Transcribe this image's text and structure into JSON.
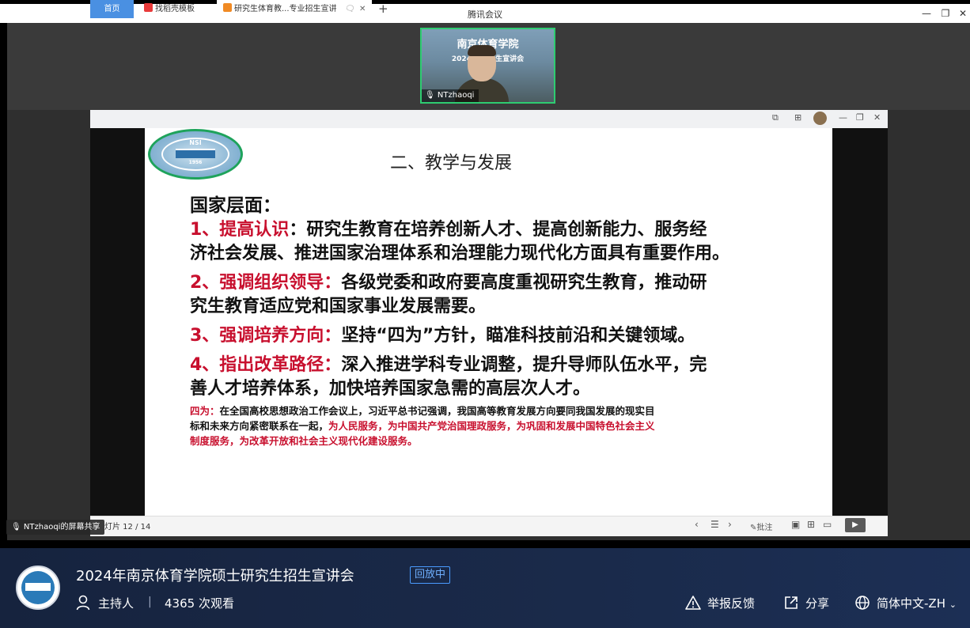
{
  "window": {
    "title": "腾讯会议"
  },
  "video": {
    "participant_name": "NTzhaoqi",
    "banner_line1": "南京体育学院",
    "banner_line2": "2024年 生招生宣讲会"
  },
  "browser_tabs": [
    {
      "label": "首页"
    },
    {
      "label": "找稻壳模板"
    },
    {
      "label": "研究生体育教...专业招生宣讲"
    }
  ],
  "logo": {
    "top_text": "NSI",
    "year": "1956"
  },
  "slide": {
    "title": "二、教学与发展",
    "heading": "国家层面：",
    "points": [
      {
        "label": "1、提高认识",
        "text_line1": "：研究生教育在培养创新人才、提高创新能力、服务经",
        "text_line2": "济社会发展、推进国家治理体系和治理能力现代化方面具有重要作用。"
      },
      {
        "label": "2、强调组织领导：",
        "text_line1": "各级党委和政府要高度重视研究生教育，推动研",
        "text_line2": "究生教育适应党和国家事业发展需要。"
      },
      {
        "label": "3、强调培养方向：",
        "text_line1": "坚持“四为”方针，瞄准科技前沿和关键领域。",
        "text_line2": ""
      },
      {
        "label": "4、指出改革路径：",
        "text_line1": "深入推进学科专业调整，提升导师队伍水平，完",
        "text_line2": "善人才培养体系，加快培养国家急需的高层次人才。"
      }
    ],
    "note": {
      "label": "四为：",
      "line1": "在全国高校思想政治工作会议上，习近平总书记强调，我国高等教育发展方向要同我国发展的现实目",
      "line2_black": "标和未来方向紧密联系在一起，",
      "line2_red": "为人民服务，为中国共产党治国理政服务，为巩固和发展中国特色社会主义",
      "line3_red": "制度服务，为改革开放和社会主义现代化建设服务。"
    }
  },
  "presentation_status": {
    "slide_counter": "灯片 12 / 14",
    "annotate_label": "批注"
  },
  "screen_share": {
    "label": "NTzhaoqi的屏幕共享"
  },
  "live": {
    "title": "2024年南京体育学院硕士研究生招生宣讲会",
    "status": "回放中",
    "host_label": "主持人",
    "divider": "|",
    "views": "4365 次观看",
    "report_label": "举报反馈",
    "share_label": "分享",
    "language_label": "简体中文-ZH"
  },
  "colors": {
    "accent_red": "#c8102e",
    "active_tab": "#4a90e2",
    "speaker_border": "#2ecc71",
    "badge_blue": "#4a9bff"
  }
}
